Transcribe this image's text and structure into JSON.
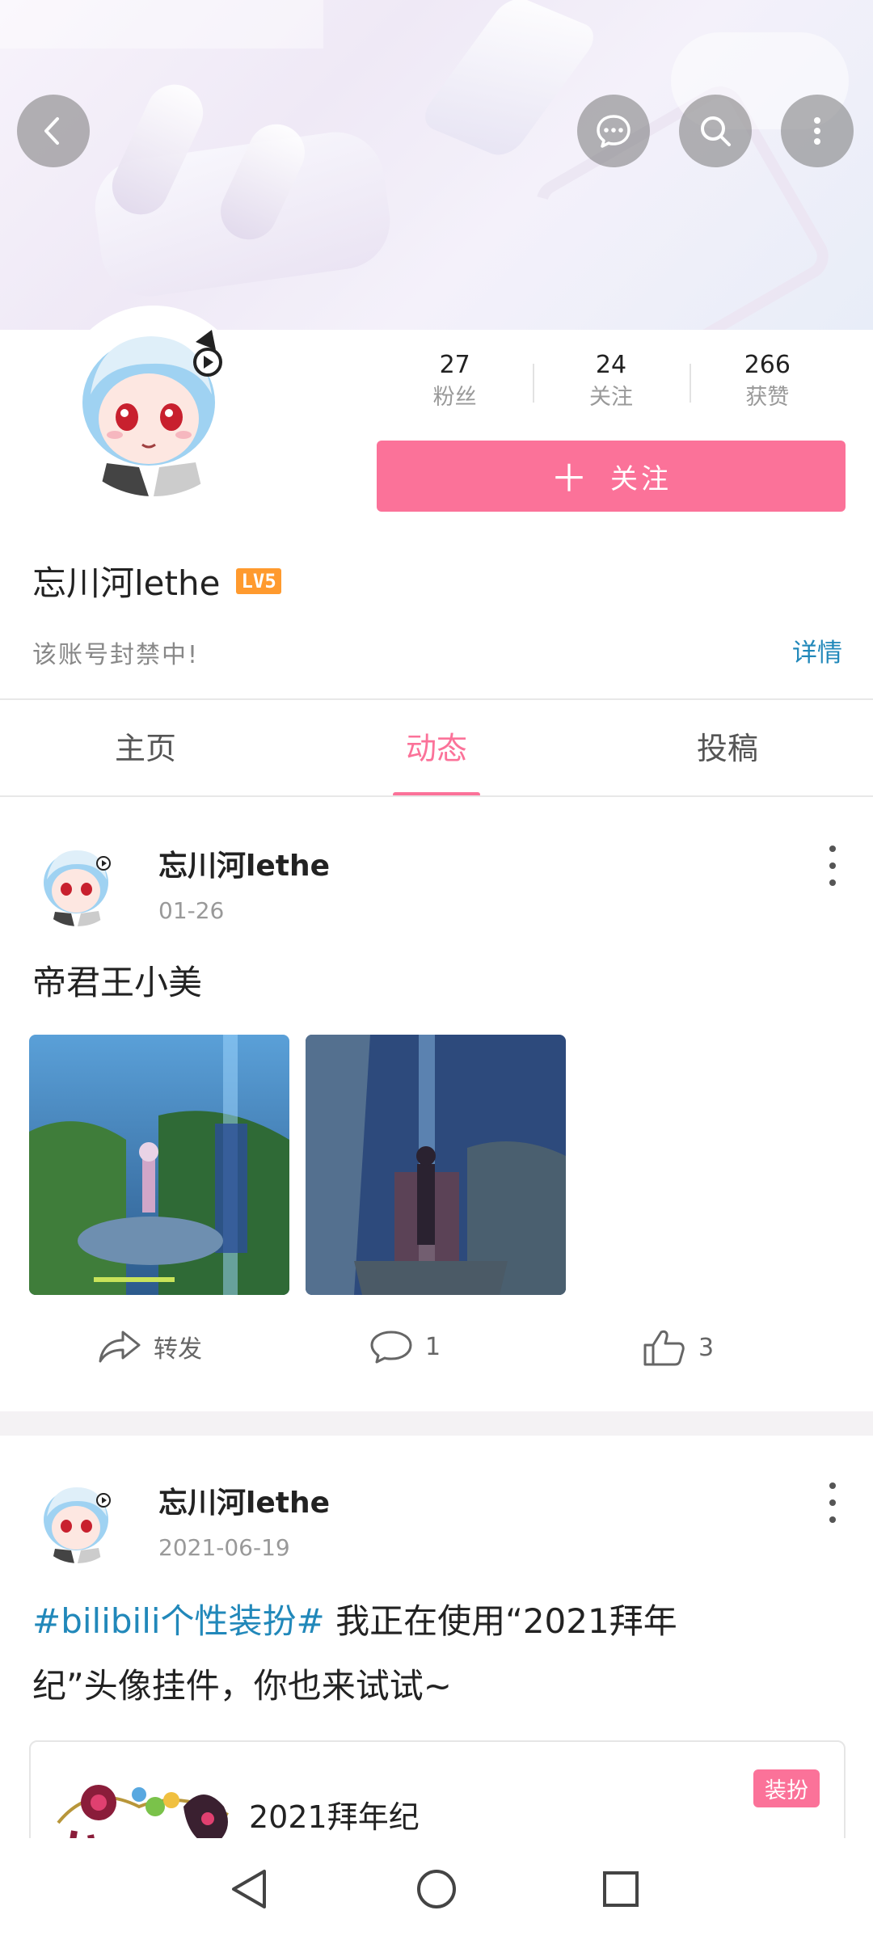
{
  "header": {
    "back_icon": "chevron-left-icon",
    "message_icon": "message-bubble-icon",
    "search_icon": "search-icon",
    "more_icon": "more-vertical-icon"
  },
  "profile": {
    "stats": [
      {
        "value": "27",
        "label": "粉丝"
      },
      {
        "value": "24",
        "label": "关注"
      },
      {
        "value": "266",
        "label": "获赞"
      }
    ],
    "follow_label": "关注",
    "username": "忘川河lethe",
    "level": "LV5",
    "signature": "该账号封禁中!",
    "details_label": "详情"
  },
  "tabs": [
    {
      "label": "主页",
      "active": false
    },
    {
      "label": "动态",
      "active": true
    },
    {
      "label": "投稿",
      "active": false
    }
  ],
  "posts": [
    {
      "author": "忘川河lethe",
      "date": "01-26",
      "text": "帝君王小美",
      "repost_label": "转发",
      "comments": "1",
      "likes": "3"
    },
    {
      "author": "忘川河lethe",
      "date": "2021-06-19",
      "hashtag": "#bilibili个性装扮#",
      "text_line1": " 我正在使用“2021拜年",
      "text_line2": "纪”头像挂件，你也来试试~",
      "card_title": "2021拜年纪",
      "card_tag": "装扮"
    }
  ],
  "colors": {
    "accent": "#fb7299",
    "link": "#2188ba",
    "level_badge": "#ff9a2e"
  }
}
